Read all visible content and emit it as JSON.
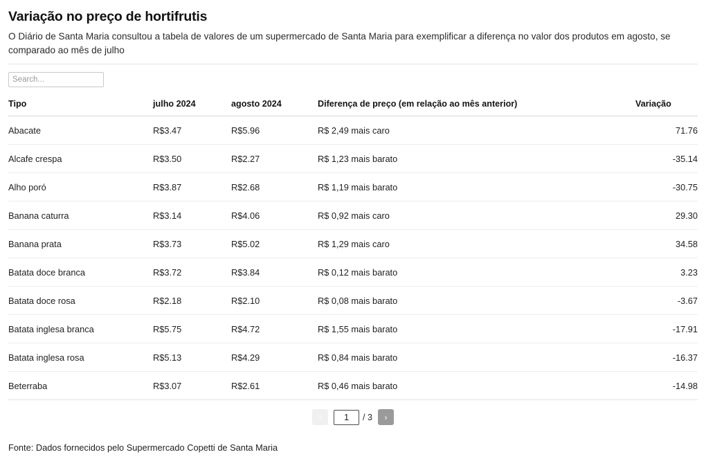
{
  "header": {
    "title": "Variação no preço de hortifrutis",
    "subtitle": "O Diário de Santa Maria consultou a tabela de valores de um supermercado de Santa Maria para exemplificar a diferença no valor dos produtos em agosto, se comparado ao mês de julho"
  },
  "search": {
    "placeholder": "Search...",
    "value": ""
  },
  "table": {
    "columns": [
      "Tipo",
      "julho 2024",
      "agosto 2024",
      "Diferença de preço (em relação ao mês anterior)",
      "Variação"
    ],
    "rows": [
      {
        "tipo": "Abacate",
        "julho": "R$3.47",
        "agosto": "R$5.96",
        "diferenca": "R$ 2,49 mais caro",
        "variacao": "71.76"
      },
      {
        "tipo": "Alcafe crespa",
        "julho": "R$3.50",
        "agosto": "R$2.27",
        "diferenca": "R$ 1,23 mais barato",
        "variacao": "-35.14"
      },
      {
        "tipo": "Alho poró",
        "julho": "R$3.87",
        "agosto": "R$2.68",
        "diferenca": "R$ 1,19 mais barato",
        "variacao": "-30.75"
      },
      {
        "tipo": "Banana caturra",
        "julho": "R$3.14",
        "agosto": "R$4.06",
        "diferenca": "R$ 0,92 mais caro",
        "variacao": "29.30"
      },
      {
        "tipo": "Banana prata",
        "julho": "R$3.73",
        "agosto": "R$5.02",
        "diferenca": "R$ 1,29 mais caro",
        "variacao": "34.58"
      },
      {
        "tipo": "Batata doce branca",
        "julho": "R$3.72",
        "agosto": "R$3.84",
        "diferenca": "R$ 0,12 mais barato",
        "variacao": "3.23"
      },
      {
        "tipo": "Batata doce rosa",
        "julho": "R$2.18",
        "agosto": "R$2.10",
        "diferenca": "R$ 0,08 mais barato",
        "variacao": "-3.67"
      },
      {
        "tipo": "Batata inglesa branca",
        "julho": "R$5.75",
        "agosto": "R$4.72",
        "diferenca": "R$ 1,55 mais barato",
        "variacao": "-17.91"
      },
      {
        "tipo": "Batata inglesa rosa",
        "julho": "R$5.13",
        "agosto": "R$4.29",
        "diferenca": "R$ 0,84 mais barato",
        "variacao": "-16.37"
      },
      {
        "tipo": "Beterraba",
        "julho": "R$3.07",
        "agosto": "R$2.61",
        "diferenca": "R$ 0,46 mais barato",
        "variacao": "-14.98"
      }
    ]
  },
  "pagination": {
    "prev_icon": "chevron-left-icon",
    "prev_label": "‹",
    "next_icon": "chevron-right-icon",
    "next_label": "›",
    "current_page": "1",
    "total_label": "/ 3",
    "total_pages": "3",
    "prev_enabled": false,
    "next_enabled": true
  },
  "footer": {
    "source": "Fonte: Dados fornecidos pelo Supermercado Copetti de Santa Maria"
  },
  "colors": {
    "text": "#212121",
    "rule": "#e3e3e3",
    "row_divider": "#ededed",
    "pager_active": "#9a9a9a",
    "pager_disabled": "#f0f0f0"
  }
}
